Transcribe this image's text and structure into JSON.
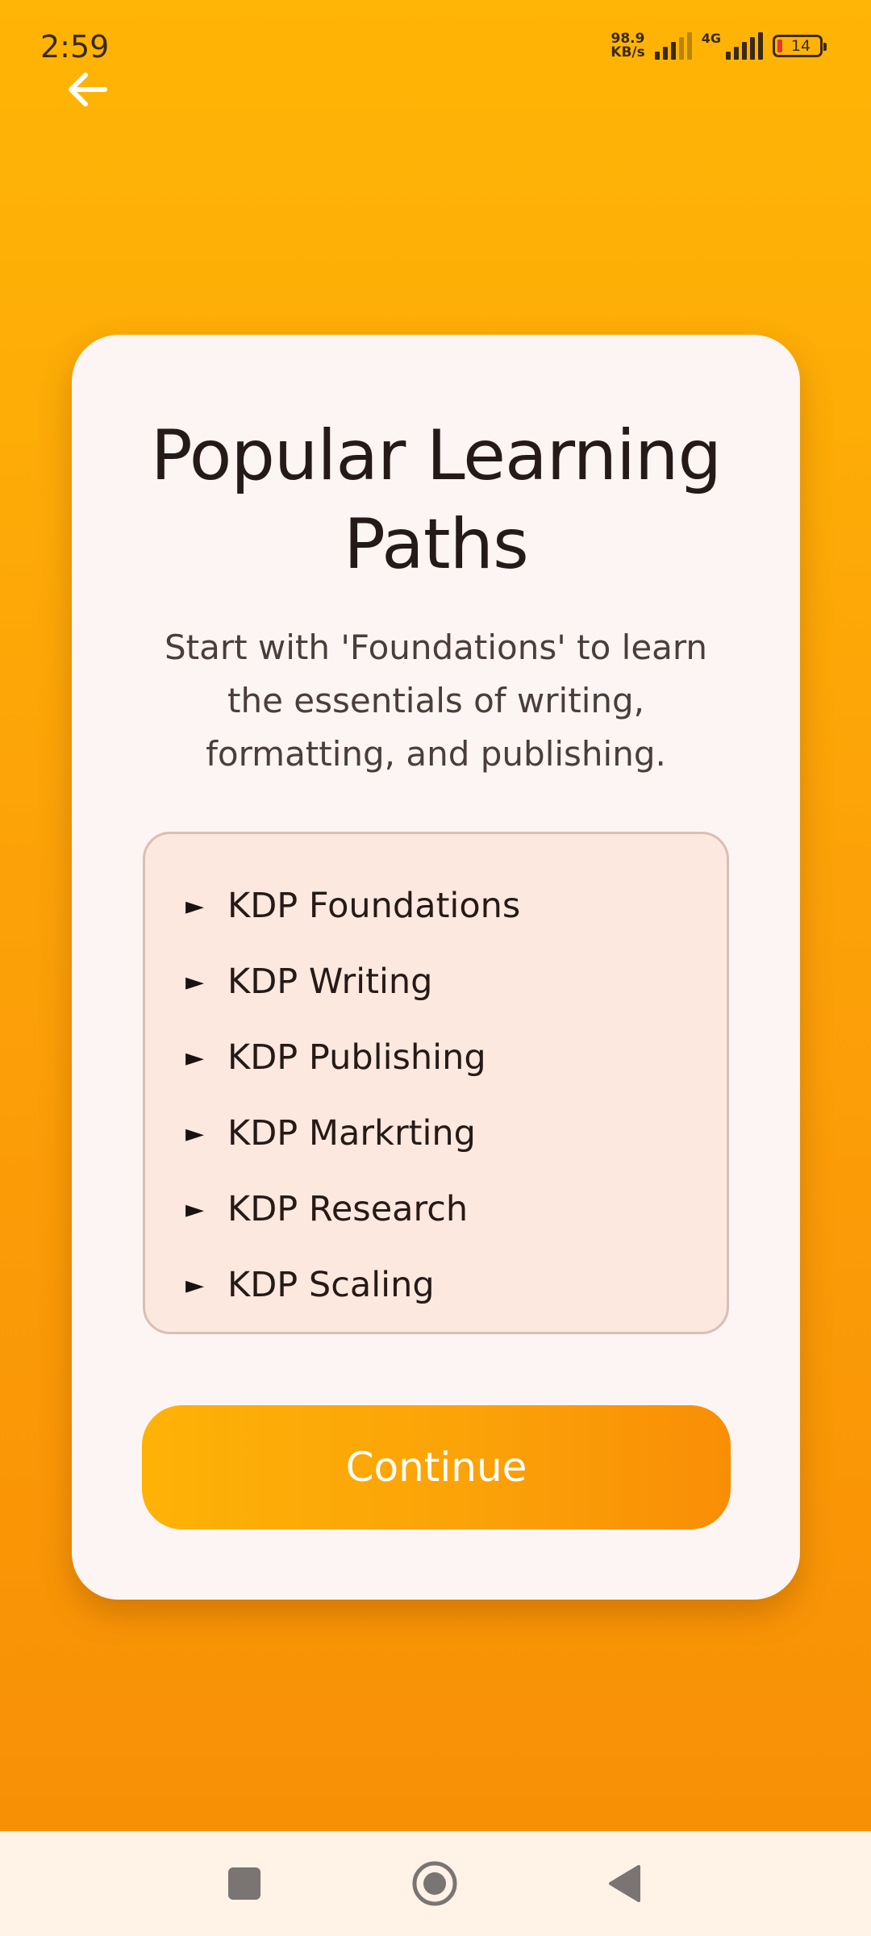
{
  "status_bar": {
    "time": "2:59",
    "net_speed_value": "98.9",
    "net_speed_unit": "KB/s",
    "network_type": "4G",
    "battery_level": "14"
  },
  "card": {
    "title": "Popular Learning Paths",
    "subtitle": "Start with 'Foundations' to learn the essentials of writing, formatting, and publishing.",
    "paths": [
      {
        "arrow": "►",
        "label": "KDP Foundations"
      },
      {
        "arrow": "►",
        "label": "KDP Writing"
      },
      {
        "arrow": "►",
        "label": "KDP Publishing"
      },
      {
        "arrow": "►",
        "label": "KDP Markrting"
      },
      {
        "arrow": "►",
        "label": "KDP Research"
      },
      {
        "arrow": "►",
        "label": "KDP Scaling"
      }
    ],
    "continue_label": "Continue"
  },
  "icons": {
    "back": "back-arrow-icon",
    "nav_recents": "square-icon",
    "nav_home": "circle-icon",
    "nav_back": "triangle-icon"
  },
  "colors": {
    "background_top": "#FFB505",
    "background_bottom": "#F88E05",
    "card_bg": "#FDF5F3",
    "list_bg": "#FCE8DF",
    "button_start": "#FEB206",
    "button_end": "#F98E05"
  }
}
